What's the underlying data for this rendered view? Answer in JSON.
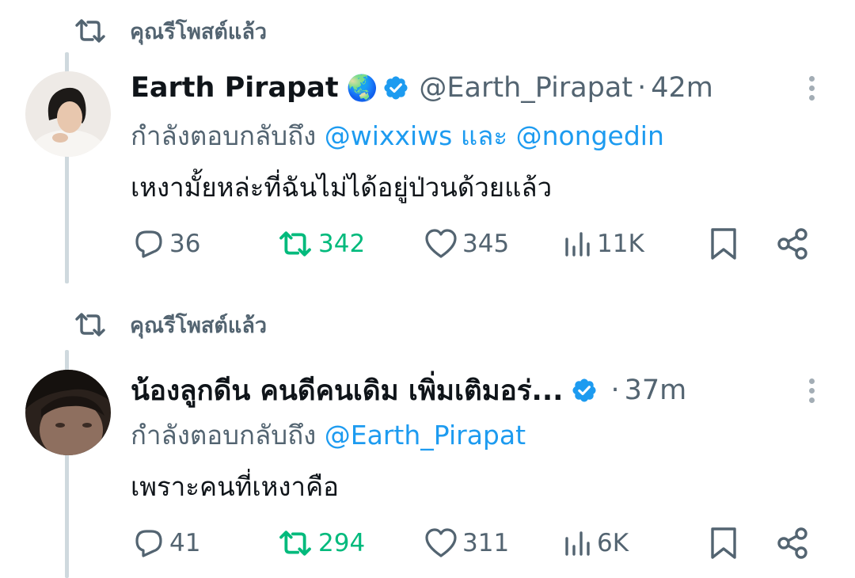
{
  "tweets": [
    {
      "retweet_label": "คุณรีโพสต์แล้ว",
      "name": "Earth Pirapat",
      "handle": "@Earth_Pirapat",
      "dot": "·",
      "time": "42m",
      "reply_prefix": "กำลังตอบกลับถึง",
      "mention1": "@wixxiws",
      "conj": "และ",
      "mention2": "@nongedin",
      "text": "เหงามั้ยหล่ะที่ฉันไม่ได้อยู่ป่วนด้วยแล้ว",
      "replies": "36",
      "retweets": "342",
      "likes": "345",
      "views": "11K",
      "globe_emoji": "🌏"
    },
    {
      "retweet_label": "คุณรีโพสต์แล้ว",
      "name": "น้องลูกดีน คนดีคนเดิม เพิ่มเติมอร่...",
      "dot": "·",
      "time": "37m",
      "reply_prefix": "กำลังตอบกลับถึง",
      "mention1": "@Earth_Pirapat",
      "text": "เพราะคนที่เหงาคือ",
      "replies": "41",
      "retweets": "294",
      "likes": "311",
      "views": "6K"
    }
  ],
  "colors": {
    "accent": "#1d9bf0",
    "retweet_green": "#00ba7c",
    "muted": "#536471"
  }
}
